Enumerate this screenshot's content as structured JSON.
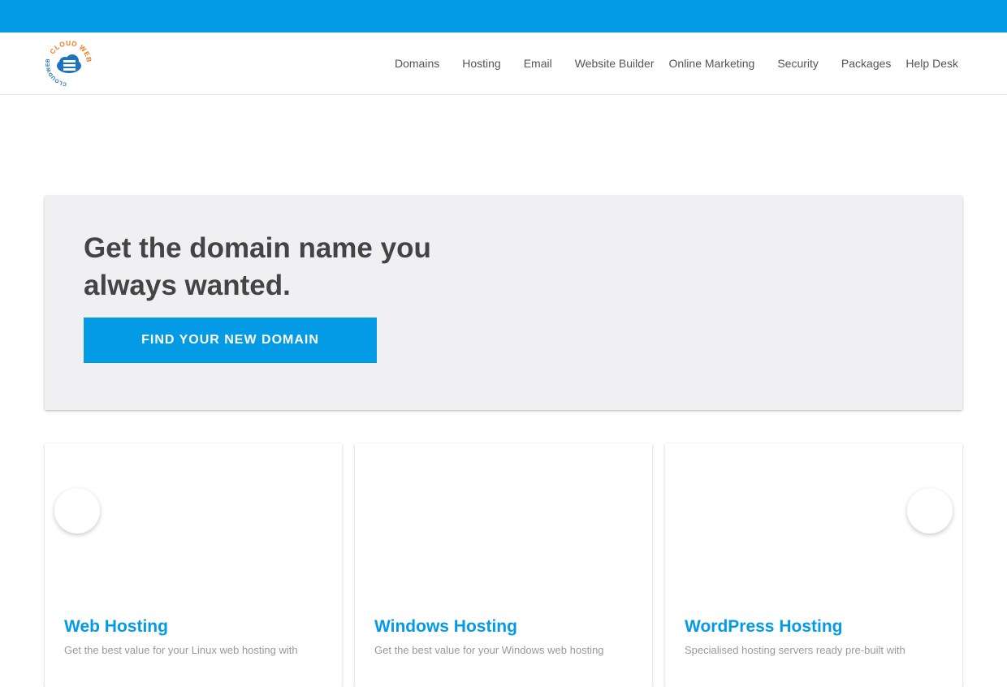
{
  "brand": {
    "logo_alt": "Cloud Webs",
    "accent": "#039be5",
    "logo_orange": "#f47b20",
    "logo_blue": "#1e73be"
  },
  "nav": {
    "items": [
      {
        "label": "Domains"
      },
      {
        "label": "Hosting"
      },
      {
        "label": "Email"
      },
      {
        "label": "Website Builder"
      },
      {
        "label": "Online Marketing"
      },
      {
        "label": "Security"
      },
      {
        "label": "Packages"
      },
      {
        "label": "Help Desk"
      }
    ]
  },
  "hero": {
    "title": "Get the domain name you always wanted.",
    "button_label": "FIND YOUR NEW DOMAIN"
  },
  "cards": [
    {
      "title": "Web Hosting",
      "text": "Get the best value for your Linux web hosting with"
    },
    {
      "title": "Windows Hosting",
      "text": "Get the best value for your Windows web hosting"
    },
    {
      "title": "WordPress Hosting",
      "text": "Specialised hosting servers ready pre-built with"
    }
  ]
}
